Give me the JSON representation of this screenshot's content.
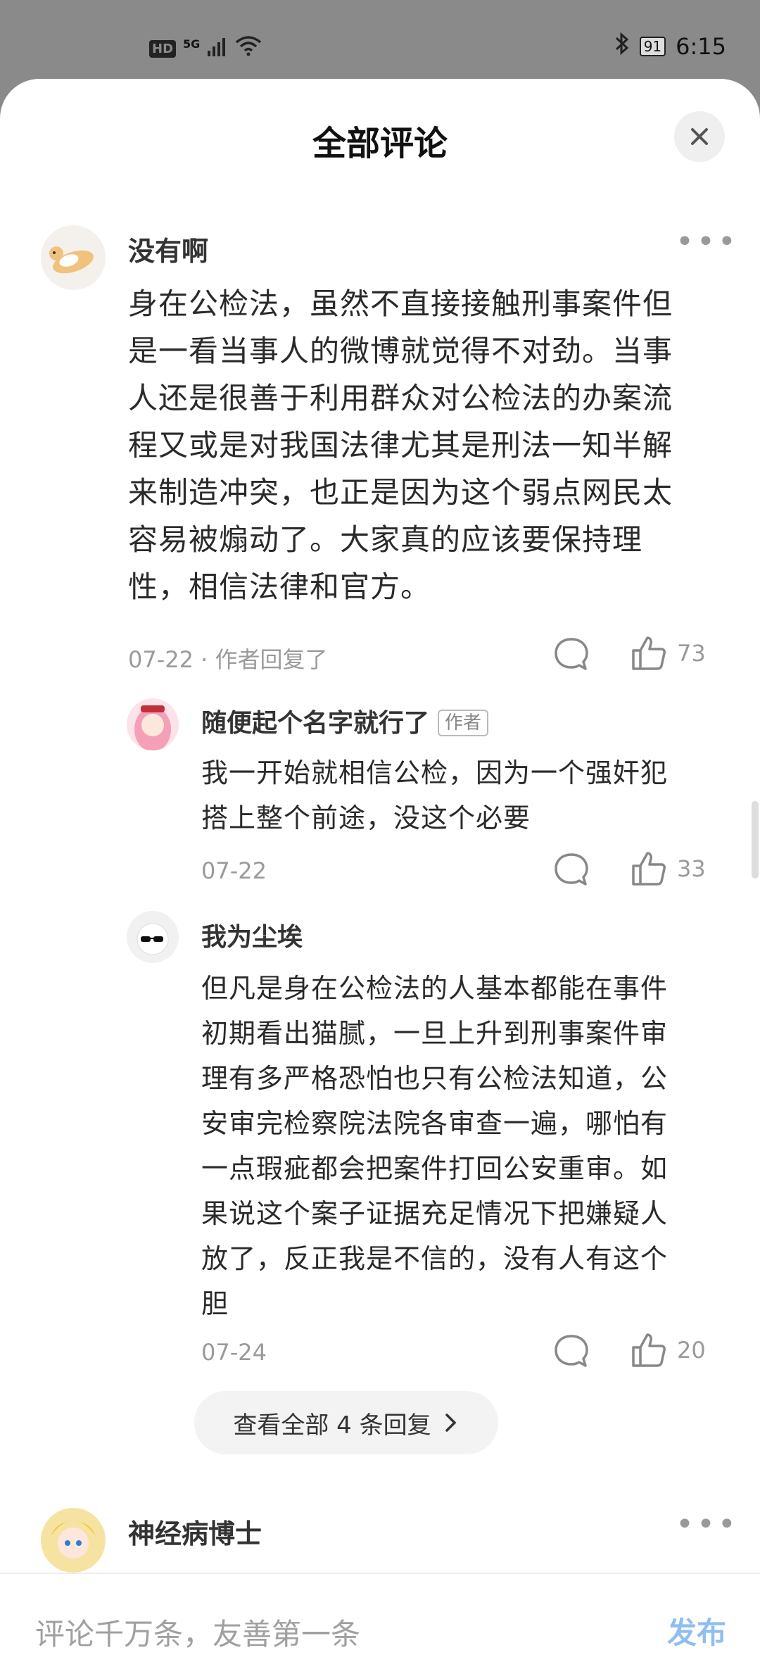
{
  "status_bar": {
    "network": "5G",
    "hd": "HD",
    "battery": "91",
    "time": "6:15"
  },
  "sheet": {
    "title": "全部评论",
    "close_icon": "close-icon"
  },
  "comments": [
    {
      "user": "没有啊",
      "avatar_icon": "cat-avatar-icon",
      "text_lines": [
        "身在公检法，虽然不直接接触刑事案件但",
        "是一看当事人的微博就觉得不对劲。当事",
        "人还是很善于利用群众对公检法的办案流",
        "程又或是对我国法律尤其是刑法一知半解",
        "来制造冲突，也正是因为这个弱点网民太",
        "容易被煽动了。大家真的应该要保持理",
        "性，相信法律和官方。"
      ],
      "meta": "07-22 · 作者回复了",
      "likes": "73"
    },
    {
      "user": "神经病博士",
      "avatar_icon": "anime-avatar-icon"
    }
  ],
  "replies": [
    {
      "user": "随便起个名字就行了",
      "tag": "作者",
      "text_lines": [
        "我一开始就相信公检，因为一个强奸犯",
        "搭上整个前途，没这个必要"
      ],
      "date": "07-22",
      "likes": "33"
    },
    {
      "user": "我为尘埃",
      "text_lines": [
        "但凡是身在公检法的人基本都能在事件",
        "初期看出猫腻，一旦上升到刑事案件审",
        "理有多严格恐怕也只有公检法知道，公",
        "安审完检察院法院各审查一遍，哪怕有",
        "一点瑕疵都会把案件打回公安重审。如",
        "果说这个案子证据充足情况下把嫌疑人",
        "放了，反正我是不信的，没有人有这个",
        "胆"
      ],
      "date": "07-24",
      "likes": "20"
    }
  ],
  "view_all": {
    "label": "查看全部 4 条回复"
  },
  "bottom": {
    "placeholder": "评论千万条，友善第一条",
    "send": "发布"
  }
}
